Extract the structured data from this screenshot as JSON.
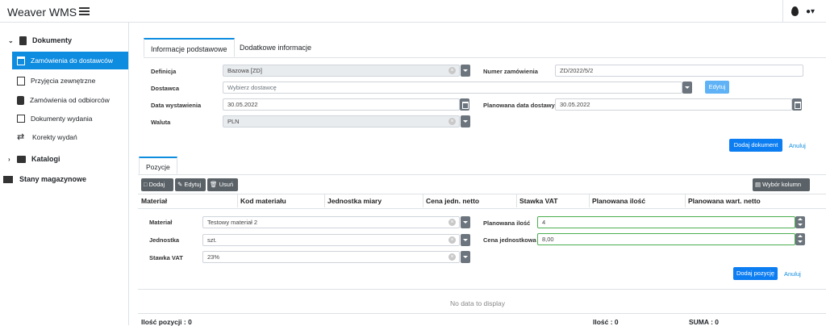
{
  "app": {
    "title": "Weaver WMS"
  },
  "sidebar": {
    "dokumenty": "Dokumenty",
    "items": [
      {
        "label": "Zamówienia do dostawców"
      },
      {
        "label": "Przyjęcia zewnętrzne"
      },
      {
        "label": "Zamówienia od odbiorców"
      },
      {
        "label": "Dokumenty wydania"
      },
      {
        "label": "Korekty wydań"
      }
    ],
    "katalogi": "Katalogi",
    "stany": "Stany magazynowe"
  },
  "tabs": {
    "basic": "Informacje podstawowe",
    "extra": "Dodatkowe informacje"
  },
  "form": {
    "definicja_label": "Definicja",
    "definicja_value": "Bazowa [ZD]",
    "numer_label": "Numer zamówienia",
    "numer_value": "ZD/2022/5/2",
    "dostawca_label": "Dostawca",
    "dostawca_placeholder": "Wybierz dostawcę",
    "edytuj": "Edytuj",
    "data_label": "Data wystawienia",
    "data_value": "30.05.2022",
    "plan_data_label": "Planowana data dostawy",
    "plan_data_value": "30.05.2022",
    "waluta_label": "Waluta",
    "waluta_value": "PLN",
    "add_doc": "Dodaj dokument",
    "cancel": "Anuluj"
  },
  "pozycje": {
    "tab": "Pozycje",
    "toolbar": {
      "add": "Dodaj",
      "edit": "Edytuj",
      "del": "Usuń",
      "columns": "Wybór kolumn"
    },
    "columns": [
      "Materiał",
      "Kod materiału",
      "Jednostka miary",
      "Cena jedn. netto",
      "Stawka VAT",
      "Planowana ilość",
      "Planowana wart. netto"
    ],
    "form": {
      "material_label": "Materiał",
      "material_value": "Testowy materiał 2",
      "jednostka_label": "Jednostka",
      "jednostka_value": "szt.",
      "vat_label": "Stawka VAT",
      "vat_value": "23%",
      "ilosc_label": "Planowana ilość",
      "ilosc_value": "4",
      "cena_label": "Cena jednostkowa",
      "cena_value": "8,00",
      "add": "Dodaj pozycję",
      "cancel": "Anuluj"
    },
    "nodata": "No data to display",
    "footer": {
      "count": "Ilość pozycji : 0",
      "qty": "Ilość : 0",
      "sum": "SUMA : 0"
    }
  }
}
